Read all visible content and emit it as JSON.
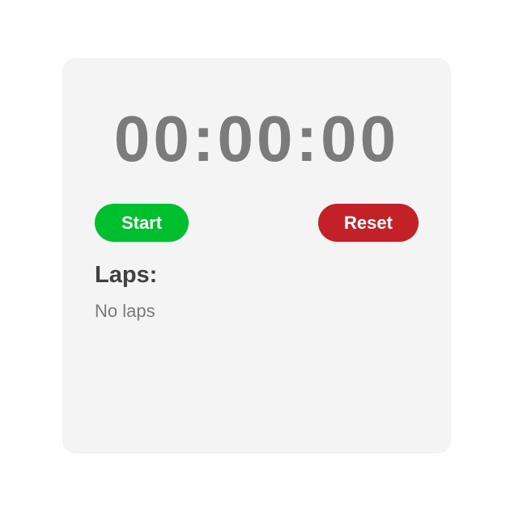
{
  "stopwatch": {
    "display": "00:00:00",
    "start_label": "Start",
    "reset_label": "Reset",
    "laps_title": "Laps:",
    "laps_empty": "No laps",
    "laps": []
  },
  "colors": {
    "card_background": "#f4f4f4",
    "timer_text": "#7b7b7b",
    "start_button": "#00bf2f",
    "reset_button": "#c22127",
    "laps_title": "#404040",
    "laps_empty": "#7a7a7a"
  }
}
